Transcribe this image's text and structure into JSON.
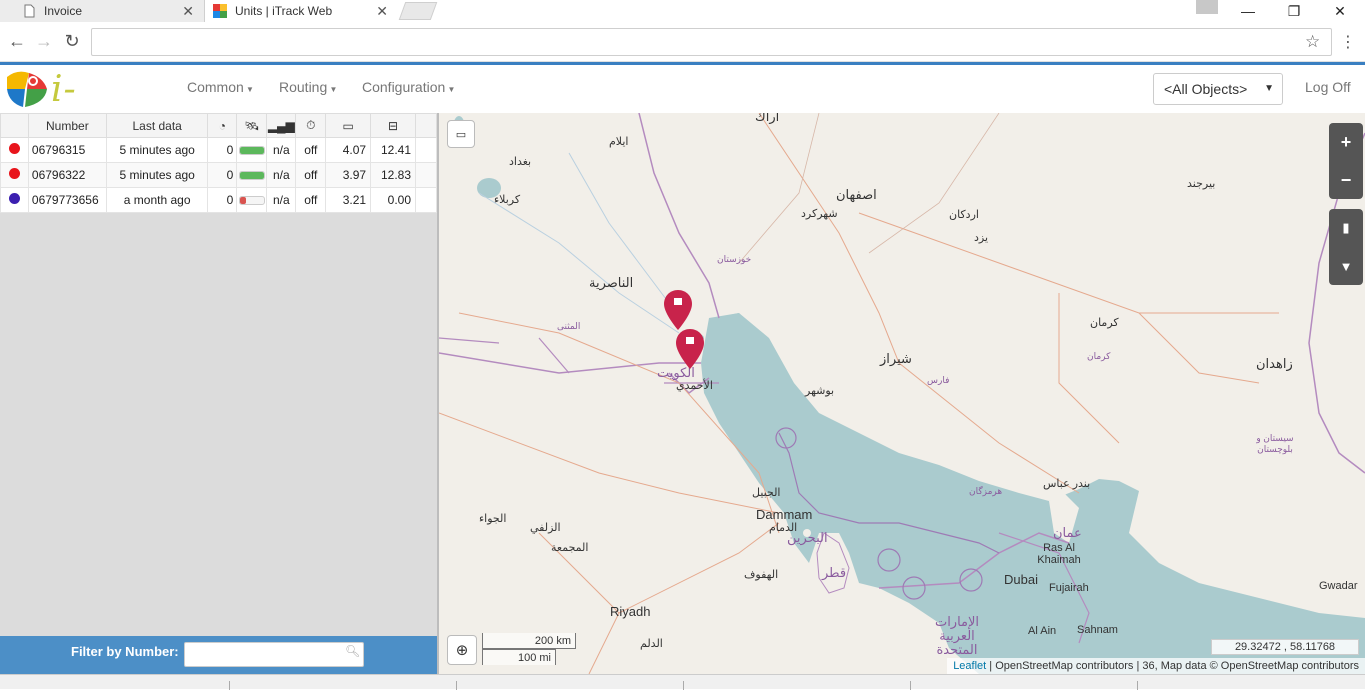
{
  "browser": {
    "tabs": [
      {
        "title": "Invoice",
        "active": false
      },
      {
        "title": "Units | iTrack Web",
        "active": true
      }
    ],
    "url": "",
    "window_controls": {
      "minimize": "—",
      "restore": "❐",
      "close": "✕"
    }
  },
  "app": {
    "logo_text": "i-track",
    "menu": [
      {
        "label": "Common"
      },
      {
        "label": "Routing"
      },
      {
        "label": "Configuration"
      }
    ],
    "object_select": "<All Objects>",
    "logoff": "Log Off"
  },
  "units_table": {
    "columns": [
      "Number",
      "Last data"
    ],
    "icon_columns": [
      "speedometer-icon",
      "satellite-icon",
      "gsm-signal-icon",
      "ignition-icon",
      "battery-icon",
      "power-supply-icon"
    ],
    "rows": [
      {
        "status_color": "#e8141b",
        "number": "06796315",
        "last_data": "5 minutes ago",
        "speed": "0",
        "gps_signal": 1.0,
        "gps_color": "#5cb85c",
        "gsm": "n/a",
        "ignition": "off",
        "battery": "4.07",
        "power": "12.41"
      },
      {
        "status_color": "#e8141b",
        "number": "06796322",
        "last_data": "5 minutes ago",
        "speed": "0",
        "gps_signal": 1.0,
        "gps_color": "#5cb85c",
        "gsm": "n/a",
        "ignition": "off",
        "battery": "3.97",
        "power": "12.83"
      },
      {
        "status_color": "#3b1fb0",
        "number": "0679773656",
        "last_data": "a month ago",
        "speed": "0",
        "gps_signal": 0.25,
        "gps_color": "#d9534f",
        "gsm": "n/a",
        "ignition": "off",
        "battery": "3.21",
        "power": "0.00"
      }
    ]
  },
  "filter": {
    "label": "Filter by Number:",
    "placeholder": ""
  },
  "map": {
    "zoom_in": "+",
    "zoom_out": "−",
    "scale_km": "200 km",
    "scale_mi": "100 mi",
    "coordinates": "29.32472 ,  58.11768",
    "attribution_leaflet": "Leaflet",
    "attribution_osm": "OpenStreetMap contributors",
    "attribution_tail": "36, Map data © OpenStreetMap contributors",
    "labels": [
      {
        "text": "اراك",
        "kind": "big"
      },
      {
        "text": "اصفهان",
        "kind": "big"
      },
      {
        "text": "ايلام",
        "kind": "normal"
      },
      {
        "text": "بغداد",
        "kind": "normal"
      },
      {
        "text": "كربلاء",
        "kind": "normal"
      },
      {
        "text": "الناصرية",
        "kind": "big"
      },
      {
        "text": "شيراز",
        "kind": "big"
      },
      {
        "text": "كرمان",
        "kind": "normal"
      },
      {
        "text": "زاهدان",
        "kind": "big"
      },
      {
        "text": "Dammam",
        "kind": "big"
      },
      {
        "text": "الدمام",
        "kind": "normal"
      },
      {
        "text": "Riyadh",
        "kind": "big"
      },
      {
        "text": "الهفوف",
        "kind": "normal"
      },
      {
        "text": "Dubai",
        "kind": "big"
      },
      {
        "text": "Ras Al Khaimah",
        "kind": "normal"
      },
      {
        "text": "Fujairah",
        "kind": "normal"
      },
      {
        "text": "Al Ain",
        "kind": "normal"
      },
      {
        "text": "Sahnam",
        "kind": "normal"
      },
      {
        "text": "عمان",
        "kind": "big"
      },
      {
        "text": "الكويت",
        "kind": "big"
      },
      {
        "text": "الأحمدي",
        "kind": "normal"
      },
      {
        "text": "بوشهر",
        "kind": "normal"
      },
      {
        "text": "بندر عباس",
        "kind": "normal"
      },
      {
        "text": "يزد",
        "kind": "normal"
      },
      {
        "text": "اردكان",
        "kind": "normal"
      },
      {
        "text": "شهركرد",
        "kind": "normal"
      },
      {
        "text": "بيرجند",
        "kind": "normal"
      },
      {
        "text": "قطر",
        "kind": "big"
      },
      {
        "text": "البحرين",
        "kind": "big"
      },
      {
        "text": "الإمارات العربية المتحدة",
        "kind": "big"
      },
      {
        "text": "الجبيل",
        "kind": "normal"
      },
      {
        "text": "الجواء",
        "kind": "normal"
      },
      {
        "text": "الزلفي",
        "kind": "normal"
      },
      {
        "text": "المجمعة",
        "kind": "normal"
      },
      {
        "text": "الدلم",
        "kind": "normal"
      },
      {
        "text": "Gwadar",
        "kind": "normal"
      },
      {
        "text": "خوزستان",
        "kind": "purple"
      },
      {
        "text": "فارس",
        "kind": "purple"
      },
      {
        "text": "هرمزگان",
        "kind": "purple"
      },
      {
        "text": "سيستان و بلوچستان",
        "kind": "purple"
      },
      {
        "text": "المثنى",
        "kind": "purple"
      },
      {
        "text": "كرمان",
        "kind": "purple"
      }
    ]
  }
}
